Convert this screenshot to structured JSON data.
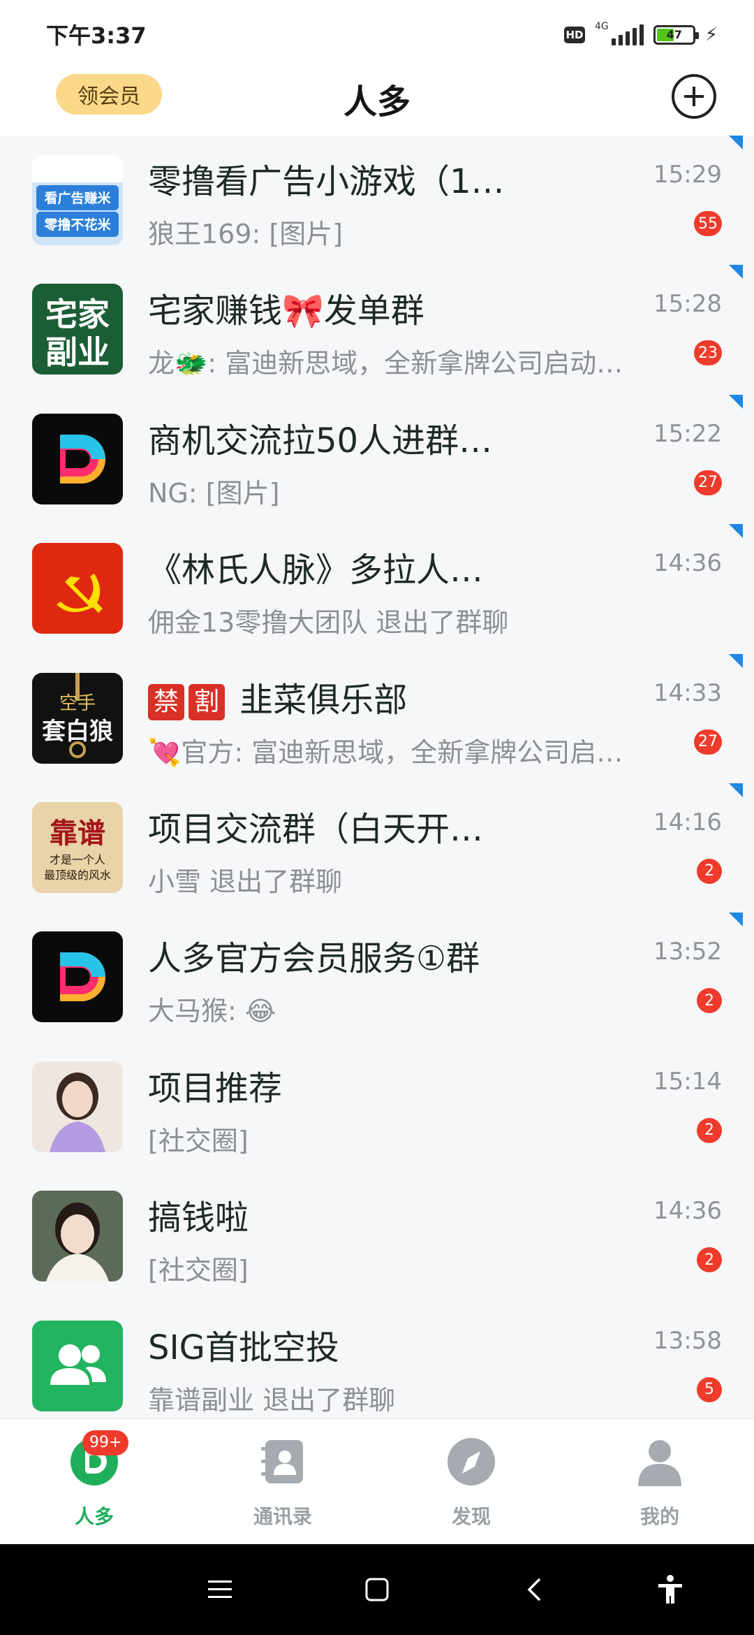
{
  "status_bar": {
    "time": "下午3:37",
    "hd": "HD",
    "network": "4G",
    "battery": "47",
    "battery_level_percent": 47
  },
  "header": {
    "vip_button": "领会员",
    "title": "人多",
    "add_icon": "plus-circle-icon"
  },
  "chats": [
    {
      "name": "零撸看广告小游戏（1…",
      "preview": "狼王169: [图片]",
      "time": "15:29",
      "unread": "55",
      "pinned_mark": true,
      "avatar_text": [
        "看广告赚米",
        "零撸不花米"
      ]
    },
    {
      "name": "宅家赚钱🎀发单群",
      "preview": "龙🐲: 富迪新思域，全新拿牌公司启动…",
      "time": "15:28",
      "unread": "23",
      "pinned_mark": true,
      "avatar_text": [
        "宅家",
        "副业"
      ]
    },
    {
      "name": "商机交流拉50人进群…",
      "preview": "NG: [图片]",
      "time": "15:22",
      "unread": "27",
      "pinned_mark": true
    },
    {
      "name": "《林氏人脉》多拉人…",
      "preview": "佣金13零撸大团队 退出了群聊",
      "time": "14:36",
      "unread": "",
      "pinned_mark": true
    },
    {
      "name": "韭菜俱乐部",
      "tags": [
        "禁",
        "割"
      ],
      "preview": "💘官方: 富迪新思域，全新拿牌公司启…",
      "time": "14:33",
      "unread": "27",
      "pinned_mark": true,
      "avatar_text": [
        "空手",
        "套白狼"
      ]
    },
    {
      "name": "项目交流群（白天开…",
      "preview": "小雪 退出了群聊",
      "time": "14:16",
      "unread": "2",
      "pinned_mark": true,
      "avatar_text": [
        "靠谱",
        "才是一个人",
        "最顶级的风水"
      ]
    },
    {
      "name": "人多官方会员服务①群",
      "preview": "大马猴: 😂",
      "time": "13:52",
      "unread": "2",
      "pinned_mark": true
    },
    {
      "name": "项目推荐",
      "preview": "[社交圈]",
      "time": "15:14",
      "unread": "2",
      "pinned_mark": false
    },
    {
      "name": "搞钱啦",
      "preview": "[社交圈]",
      "time": "14:36",
      "unread": "2",
      "pinned_mark": false
    },
    {
      "name": "SIG首批空投",
      "preview": "靠谱副业 退出了群聊",
      "time": "13:58",
      "unread": "5",
      "pinned_mark": false
    }
  ],
  "tabs": [
    {
      "label": "人多",
      "icon": "app-logo-icon",
      "badge": "99+",
      "active": true
    },
    {
      "label": "通讯录",
      "icon": "contacts-book-icon",
      "active": false
    },
    {
      "label": "发现",
      "icon": "compass-icon",
      "active": false
    },
    {
      "label": "我的",
      "icon": "person-icon",
      "active": false
    }
  ],
  "colors": {
    "accent_green": "#1fae5b",
    "badge_red": "#ee3b2c",
    "vip_gold": "#fbd98a",
    "pin_blue": "#1e88e5"
  }
}
